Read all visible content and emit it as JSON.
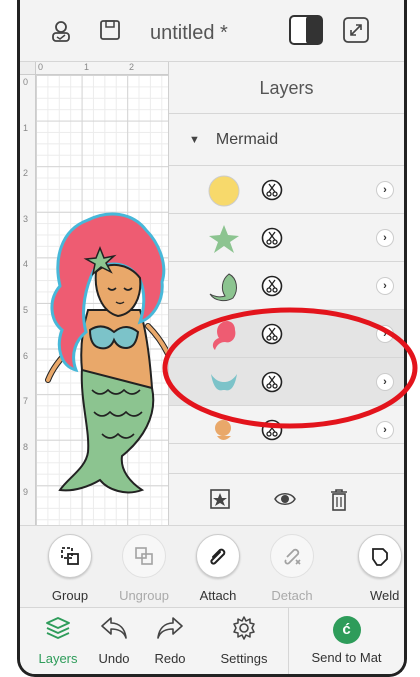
{
  "topbar": {
    "title": "untitled *"
  },
  "ruler": {
    "top": [
      "0",
      "1",
      "2"
    ],
    "left": [
      "0",
      "1",
      "2",
      "3",
      "4",
      "5",
      "6",
      "7",
      "8",
      "9"
    ]
  },
  "layers_panel": {
    "header": "Layers",
    "group_name": "Mermaid",
    "rows": [
      {
        "icon": "circle-shape",
        "color": "#f7d96b",
        "selected": false
      },
      {
        "icon": "starfish-shape",
        "color": "#8cc490",
        "selected": false
      },
      {
        "icon": "tail-shape",
        "color": "#8cc490",
        "selected": false
      },
      {
        "icon": "hair-shape",
        "color": "#ee5c72",
        "selected": true
      },
      {
        "icon": "bikini-top-shape",
        "color": "#7cc3c9",
        "selected": true
      },
      {
        "icon": "face-body-shape",
        "color": "#e9a86a",
        "selected": false
      }
    ]
  },
  "edit_toolbar": {
    "group": "Group",
    "ungroup": "Ungroup",
    "attach": "Attach",
    "detach": "Detach",
    "weld": "Weld"
  },
  "nav": {
    "layers": "Layers",
    "undo": "Undo",
    "redo": "Redo",
    "settings": "Settings",
    "send": "Send to Mat"
  },
  "colors": {
    "accent": "#2e9c5a",
    "annotation": "#e3141c",
    "hair": "#ee5c72",
    "tail": "#8cc490",
    "top": "#7cc3c9",
    "skin": "#e9a86a"
  }
}
